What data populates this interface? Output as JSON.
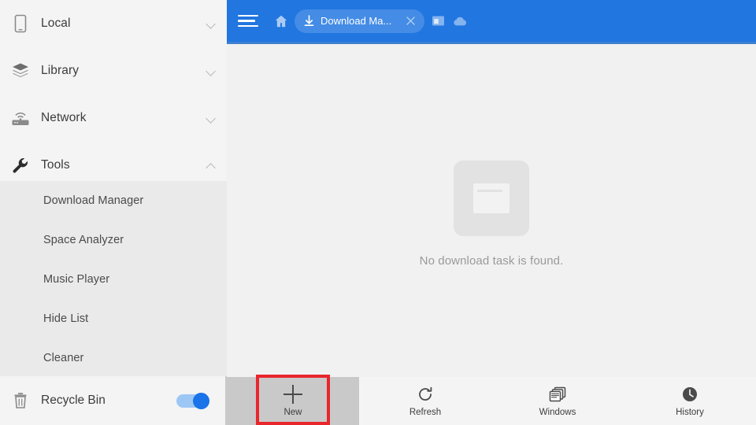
{
  "sidebar": {
    "nav_items": [
      {
        "label": "Local",
        "icon": "phone-icon",
        "chevron": "chevron-down-icon",
        "expanded": false
      },
      {
        "label": "Library",
        "icon": "layers-icon",
        "chevron": "chevron-down-icon",
        "expanded": false
      },
      {
        "label": "Network",
        "icon": "network-router-icon",
        "chevron": "chevron-down-icon",
        "expanded": false
      },
      {
        "label": "Tools",
        "icon": "wrench-icon",
        "chevron": "chevron-up-icon",
        "expanded": true
      }
    ],
    "tools_submenu": [
      {
        "label": "Download Manager"
      },
      {
        "label": "Space Analyzer"
      },
      {
        "label": "Music Player"
      },
      {
        "label": "Hide List"
      },
      {
        "label": "Cleaner"
      }
    ],
    "recycle_bin": {
      "label": "Recycle Bin",
      "icon": "trash-icon",
      "toggle_state": "on",
      "toggle_color": "#1a73e8"
    }
  },
  "header": {
    "background_color": "#2176e0",
    "menu_icon": "hamburger-menu-icon",
    "home_icon": "home-icon",
    "tab": {
      "icon": "download-arrow-icon",
      "title": "Download Ma...",
      "close_icon": "close-x-icon"
    },
    "actions": [
      {
        "icon": "window-icon"
      },
      {
        "icon": "cloud-icon"
      }
    ]
  },
  "main": {
    "empty_state": {
      "icon": "empty-folder-document-icon",
      "message": "No download task is found."
    }
  },
  "bottom_bar": {
    "items": [
      {
        "label": "New",
        "icon": "plus-icon",
        "pressed": true,
        "highlighted": true
      },
      {
        "label": "Refresh",
        "icon": "refresh-icon",
        "pressed": false,
        "highlighted": false
      },
      {
        "label": "Windows",
        "icon": "windows-stack-icon",
        "pressed": false,
        "highlighted": false
      },
      {
        "label": "History",
        "icon": "clock-icon",
        "pressed": false,
        "highlighted": false
      }
    ],
    "highlight_color": "#e8262b"
  }
}
